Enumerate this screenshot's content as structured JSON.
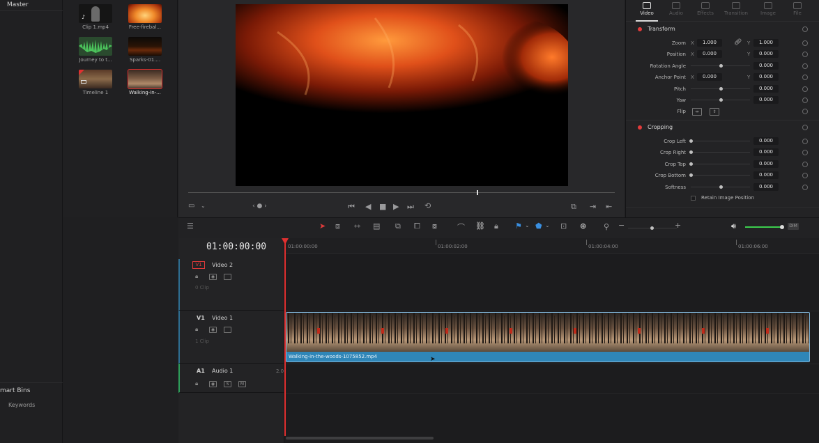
{
  "bins": {
    "master": "Master",
    "smart_bins": "mart Bins",
    "keywords": "Keywords"
  },
  "media_pool": {
    "clips": [
      {
        "label": "Clip 1.mp4"
      },
      {
        "label": "Free-firebal..."
      },
      {
        "label": "Journey to t..."
      },
      {
        "label": "Sparks-01...."
      },
      {
        "label": "Timeline 1"
      },
      {
        "label": "Walking-in-..."
      }
    ]
  },
  "inspector": {
    "tabs": [
      {
        "label": "Video",
        "active": true
      },
      {
        "label": "Audio",
        "active": false
      },
      {
        "label": "Effects",
        "active": false
      },
      {
        "label": "Transition",
        "active": false
      },
      {
        "label": "Image",
        "active": false
      },
      {
        "label": "File",
        "active": false
      }
    ],
    "transform": {
      "title": "Transform",
      "zoom_label": "Zoom",
      "zoom_x": "1.000",
      "zoom_y": "1.000",
      "position_label": "Position",
      "position_x": "0.000",
      "position_y": "0.000",
      "rotation_label": "Rotation Angle",
      "rotation": "0.000",
      "anchor_label": "Anchor Point",
      "anchor_x": "0.000",
      "anchor_y": "0.000",
      "pitch_label": "Pitch",
      "pitch": "0.000",
      "yaw_label": "Yaw",
      "yaw": "0.000",
      "flip_label": "Flip",
      "x_label": "X",
      "y_label": "Y"
    },
    "cropping": {
      "title": "Cropping",
      "crop_left_label": "Crop Left",
      "crop_left": "0.000",
      "crop_right_label": "Crop Right",
      "crop_right": "0.000",
      "crop_top_label": "Crop Top",
      "crop_top": "0.000",
      "crop_bottom_label": "Crop Bottom",
      "crop_bottom": "0.000",
      "softness_label": "Softness",
      "softness": "0.000",
      "retain_label": "Retain Image Position"
    }
  },
  "timeline": {
    "timecode": "01:00:00:00",
    "ruler": [
      "01:00:00:00",
      "01:00:02:00",
      "01:00:04:00",
      "01:00:06:00"
    ],
    "tracks": {
      "v2": {
        "id": "V1",
        "name": "Video 2",
        "clips": "0 Clip"
      },
      "v1": {
        "id": "V1",
        "name": "Video 1",
        "clips": "1 Clip"
      },
      "a1": {
        "id": "A1",
        "name": "Audio 1",
        "channels": "2.0",
        "solo": "S",
        "mute": "M"
      }
    },
    "clip_name": "Walking-in-the-woods-1075852.mp4",
    "dim_label": "DIM"
  },
  "colors": {
    "accent_red": "#e03030",
    "clip_blue": "#2f86b8",
    "volume_green": "#3ccf4e"
  }
}
